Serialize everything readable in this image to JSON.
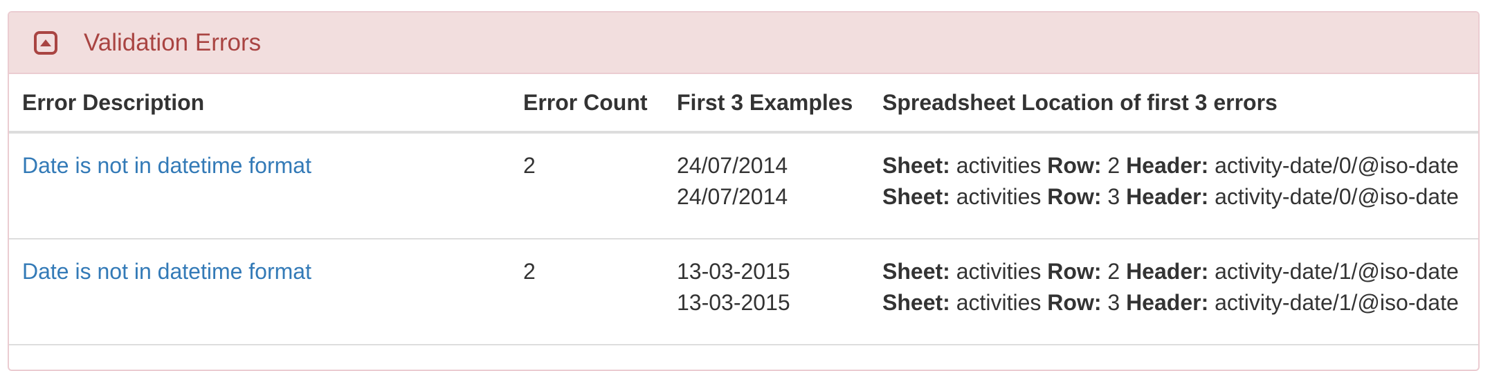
{
  "panel": {
    "title": "Validation Errors",
    "toggle_icon": "collapse-up-icon",
    "colors": {
      "heading_bg": "#f2dede",
      "heading_text": "#a94442",
      "border": "#ebccd1",
      "link": "#337ab7"
    }
  },
  "table": {
    "headers": {
      "description": "Error Description",
      "count": "Error Count",
      "examples": "First 3 Examples",
      "location": "Spreadsheet Location of first 3 errors"
    },
    "location_labels": {
      "sheet": "Sheet:",
      "row": "Row:",
      "header": "Header:"
    },
    "rows": [
      {
        "description": "Date is not in datetime format",
        "count": "2",
        "examples": [
          "24/07/2014",
          "24/07/2014"
        ],
        "locations": [
          {
            "sheet": "activities",
            "row": "2",
            "header": "activity-date/0/@iso-date"
          },
          {
            "sheet": "activities",
            "row": "3",
            "header": "activity-date/0/@iso-date"
          }
        ]
      },
      {
        "description": "Date is not in datetime format",
        "count": "2",
        "examples": [
          "13-03-2015",
          "13-03-2015"
        ],
        "locations": [
          {
            "sheet": "activities",
            "row": "2",
            "header": "activity-date/1/@iso-date"
          },
          {
            "sheet": "activities",
            "row": "3",
            "header": "activity-date/1/@iso-date"
          }
        ]
      }
    ]
  }
}
